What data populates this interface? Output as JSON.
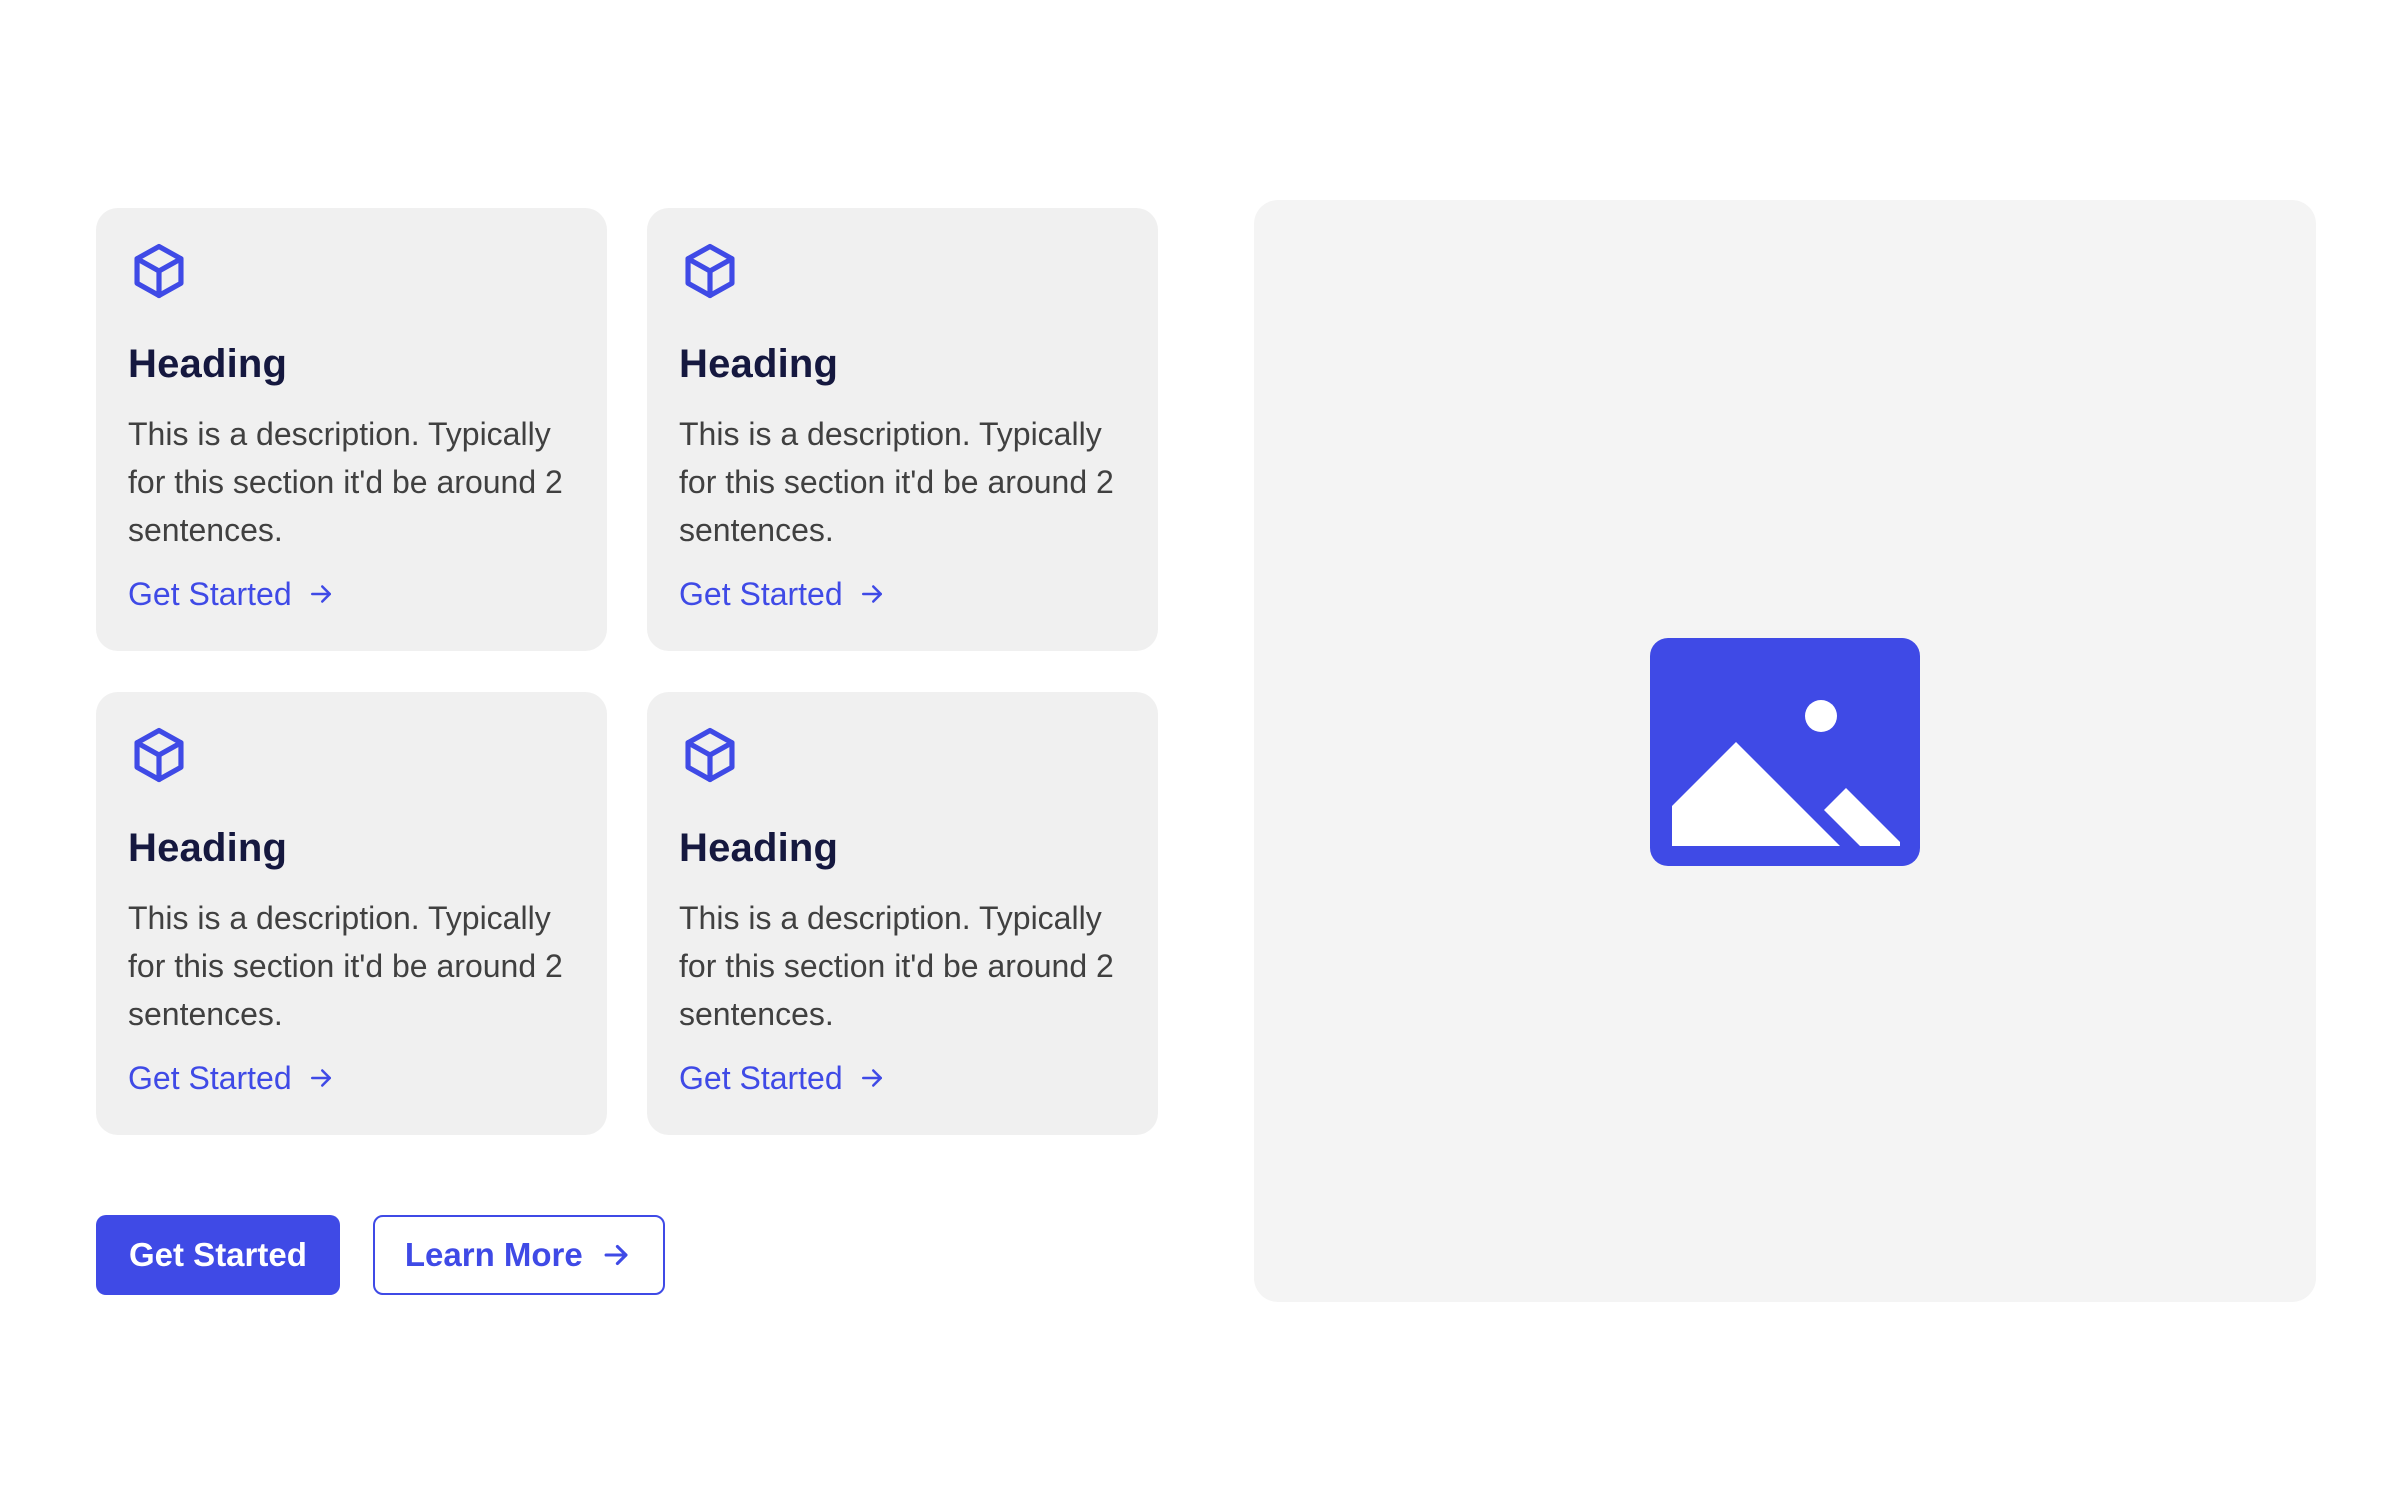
{
  "colors": {
    "accent": "#3f4ae6",
    "card_background": "#f0f0f0",
    "panel_background": "#f4f4f4",
    "heading_text": "#15183f",
    "body_text": "#404040"
  },
  "features": [
    {
      "icon": "cube-icon",
      "heading": "Heading",
      "description": "This is a description. Typically for this section it'd be around 2 sentences.",
      "link_label": "Get Started",
      "link_icon": "arrow-right-icon"
    },
    {
      "icon": "cube-icon",
      "heading": "Heading",
      "description": "This is a description. Typically for this section it'd be around 2 sentences.",
      "link_label": "Get Started",
      "link_icon": "arrow-right-icon"
    },
    {
      "icon": "cube-icon",
      "heading": "Heading",
      "description": "This is a description. Typically for this section it'd be around 2 sentences.",
      "link_label": "Get Started",
      "link_icon": "arrow-right-icon"
    },
    {
      "icon": "cube-icon",
      "heading": "Heading",
      "description": "This is a description. Typically for this section it'd be around 2 sentences.",
      "link_label": "Get Started",
      "link_icon": "arrow-right-icon"
    }
  ],
  "actions": {
    "primary_label": "Get Started",
    "secondary_label": "Learn More",
    "secondary_icon": "arrow-right-icon"
  },
  "media": {
    "icon": "image-placeholder-icon"
  }
}
